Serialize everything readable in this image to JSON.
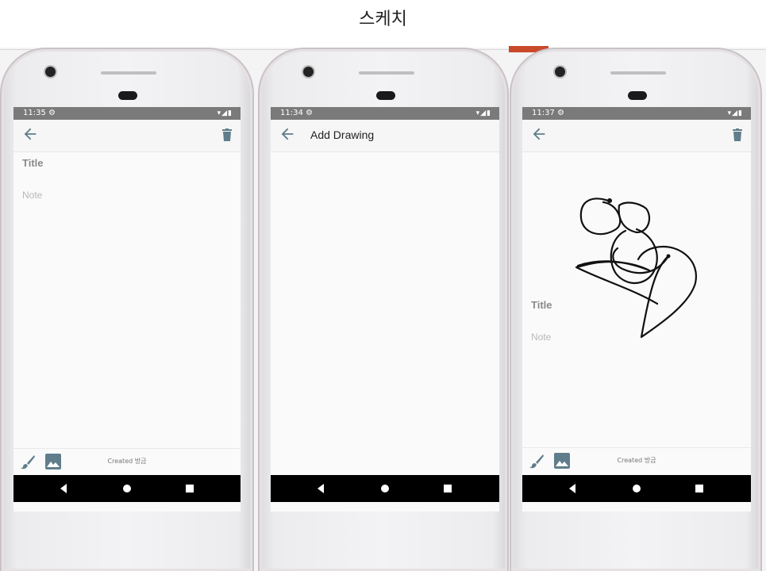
{
  "page": {
    "title": "스케치"
  },
  "phones": [
    {
      "status_time": "11:35",
      "note": {
        "title_placeholder": "Title",
        "body_placeholder": "Note"
      },
      "footer": {
        "created_label": "Created 방금"
      }
    },
    {
      "status_time": "11:34",
      "appbar_title": "Add Drawing"
    },
    {
      "status_time": "11:37",
      "note": {
        "title_placeholder": "Title",
        "body_placeholder": "Note"
      },
      "footer": {
        "created_label": "Created 방금"
      }
    }
  ],
  "icons": [
    "back-arrow-icon",
    "trash-icon",
    "brush-icon",
    "image-icon",
    "gear-icon",
    "wifi-icon",
    "signal-icon",
    "battery-icon",
    "nav-back-icon",
    "nav-home-icon",
    "nav-recents-icon"
  ],
  "colors": {
    "status_bar": "#7a7a7a",
    "icon_blue_grey": "#607d8b",
    "nav_bar": "#000000",
    "screen_bg": "#fafafa"
  }
}
